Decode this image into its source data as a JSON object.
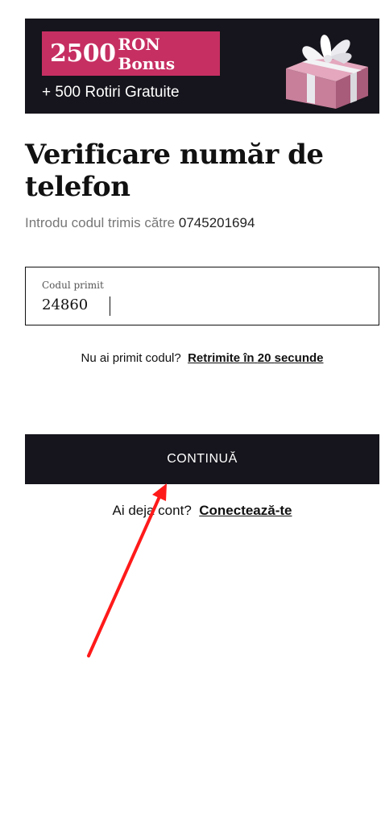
{
  "banner": {
    "amount": "2500",
    "unit": "RON Bonus",
    "subtitle": "+ 500 Rotiri Gratuite",
    "accent_color": "#c62f62",
    "background_color": "#16141c",
    "image_icon": "gift-box-icon"
  },
  "page": {
    "title": "Verificare număr de telefon",
    "subtitle_prefix": "Introdu codul trimis către",
    "phone_number": "0745201694"
  },
  "code_field": {
    "label": "Codul primit",
    "value": "24860"
  },
  "resend": {
    "prompt": "Nu ai primit codul?",
    "link_prefix": "Retrimite în",
    "seconds": "20",
    "link_suffix": "secunde"
  },
  "continue_button": {
    "label": "CONTINUĂ"
  },
  "login": {
    "prompt": "Ai deja cont?",
    "link": "Conectează-te"
  },
  "annotation": {
    "arrow_color": "#ff1a1a"
  }
}
